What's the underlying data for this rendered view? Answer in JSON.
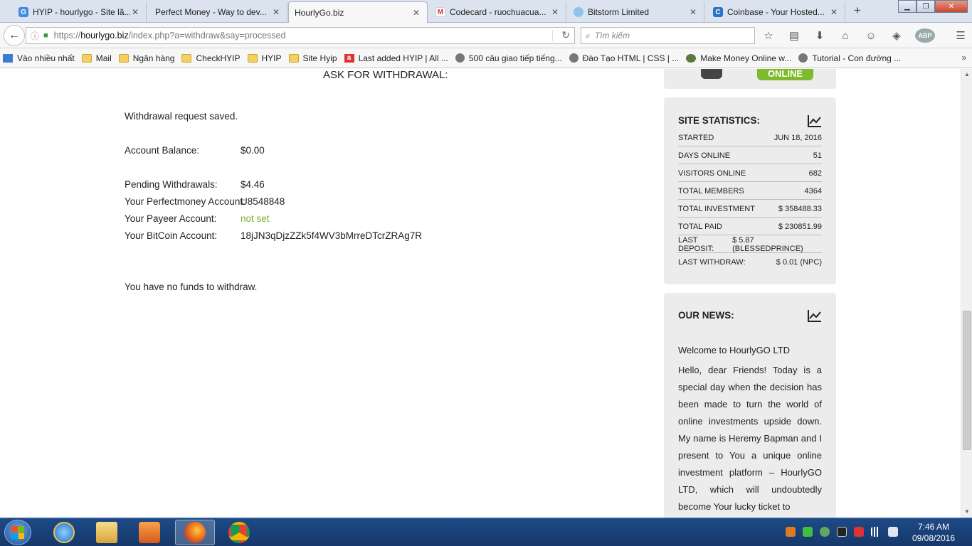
{
  "tabs": [
    {
      "title": "HYIP - hourlygo - Site lă...",
      "active": false
    },
    {
      "title": "Perfect Money - Way to dev...",
      "active": false
    },
    {
      "title": "HourlyGo.biz",
      "active": true
    },
    {
      "title": "Codecard - ruochuacua...",
      "active": false
    },
    {
      "title": "Bitstorm Limited",
      "active": false
    },
    {
      "title": "Coinbase - Your Hosted...",
      "active": false
    }
  ],
  "nav": {
    "url_scheme": "https://",
    "url_host": "hourlygo.biz",
    "url_path": "/index.php?a=withdraw&say=processed",
    "search_placeholder": "Tìm kiếm",
    "abp_label": "ABP"
  },
  "bookmarks": [
    {
      "label": "Vào nhiều nhất",
      "icon": "blue"
    },
    {
      "label": "Mail",
      "icon": "folder"
    },
    {
      "label": "Ngân hàng",
      "icon": "folder"
    },
    {
      "label": "CheckHYIP",
      "icon": "folder"
    },
    {
      "label": "HYIP",
      "icon": "folder"
    },
    {
      "label": "Site Hyip",
      "icon": "folder"
    },
    {
      "label": "Last added HYIP | All ...",
      "icon": "a"
    },
    {
      "label": "500 câu giao tiếp tiếng...",
      "icon": "globe"
    },
    {
      "label": "Đào Tạo HTML | CSS | ...",
      "icon": "globe"
    },
    {
      "label": "Make Money Online w...",
      "icon": "green"
    },
    {
      "label": "Tutorial - Con đường ...",
      "icon": "globe"
    }
  ],
  "main": {
    "heading": "ASK FOR WITHDRAWAL:",
    "saved_message": "Withdrawal request saved.",
    "balance_label": "Account Balance:",
    "balance_value": "$0.00",
    "pending_label": "Pending Withdrawals:",
    "pending_value": "$4.46",
    "pm_label": "Your Perfectmoney Account:",
    "pm_value": "U8548848",
    "payeer_label": "Your Payeer Account:",
    "payeer_value": "not set",
    "btc_label": "Your BitCoin Account:",
    "btc_value": "18jJN3qDjzZZk5f4WV3bMrreDTcrZRAg7R",
    "no_funds": "You have no funds to withdraw."
  },
  "sidebar": {
    "online_label": "ONLINE",
    "stats_title": "SITE STATISTICS:",
    "stats": [
      {
        "label": "STARTED",
        "value": "JUN 18, 2016"
      },
      {
        "label": "DAYS ONLINE",
        "value": "51"
      },
      {
        "label": "VISITORS ONLINE",
        "value": "682"
      },
      {
        "label": "TOTAL MEMBERS",
        "value": "4364"
      },
      {
        "label": "TOTAL INVESTMENT",
        "value": "$ 358488.33"
      },
      {
        "label": "TOTAL PAID",
        "value": "$ 230851.99"
      },
      {
        "label": "LAST DEPOSIT:",
        "value": "$ 5.87 (BLESSEDPRINCE)"
      },
      {
        "label": "LAST WITHDRAW:",
        "value": "$ 0.01 (NPC)"
      }
    ],
    "news_title": "OUR NEWS:",
    "news_headline": "Welcome to HourlyGO LTD",
    "news_body": "Hello, dear Friends! Today is a special day when the decision has been made to turn the world of online investments upside down. My name is Heremy Bapman and I present to You a unique online investment platform – HourlyGO LTD, which will undoubtedly become Your lucky ticket to"
  },
  "taskbar": {
    "time": "7:46 AM",
    "date": "09/08/2016"
  }
}
